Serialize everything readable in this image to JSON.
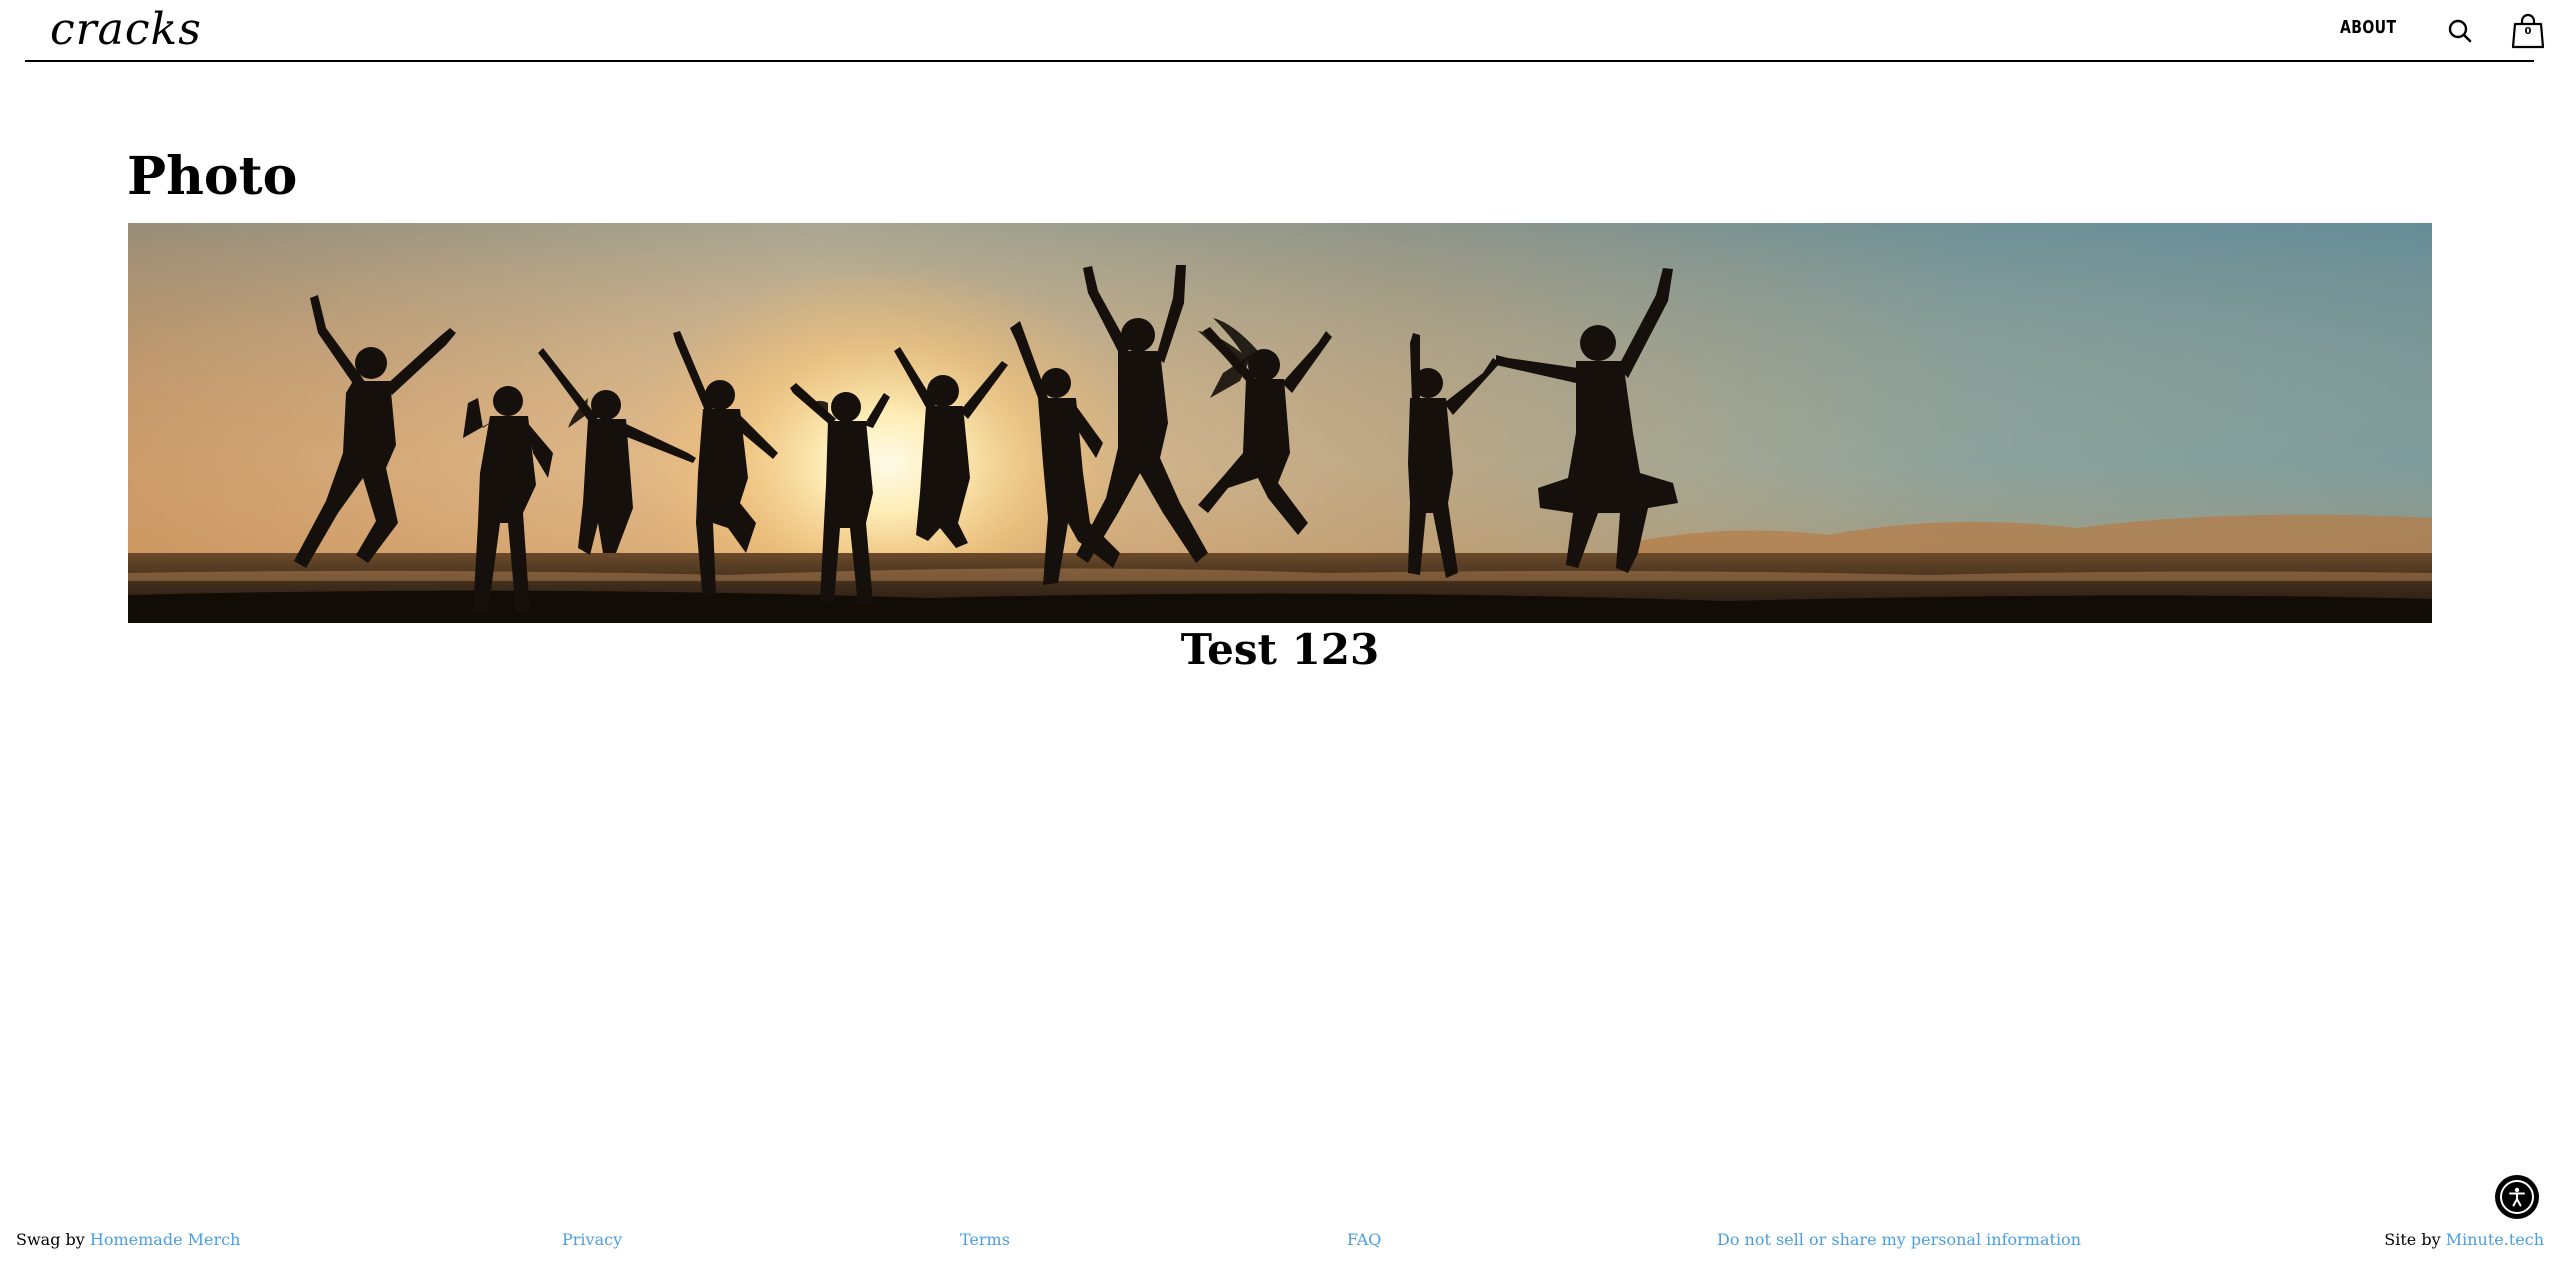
{
  "header": {
    "logo_text": "cracks",
    "nav_about": "ABOUT",
    "search_icon": "search-icon",
    "cart_icon": "shopping-bag-icon",
    "cart_count": "0"
  },
  "main": {
    "title": "Photo",
    "image_alt": "Silhouettes of people jumping on a beach at sunset",
    "caption": "Test 123"
  },
  "footer": {
    "swag_prefix": "Swag by",
    "swag_link": "Homemade Merch",
    "privacy": "Privacy",
    "terms": "Terms",
    "faq": "FAQ",
    "do_not_sell": "Do not sell or share my personal information",
    "site_prefix": "Site by",
    "site_link": "Minute.tech"
  },
  "accessibility": {
    "icon": "accessibility-icon"
  },
  "colors": {
    "link": "#4a9fe0",
    "text": "#000000",
    "background": "#ffffff"
  }
}
